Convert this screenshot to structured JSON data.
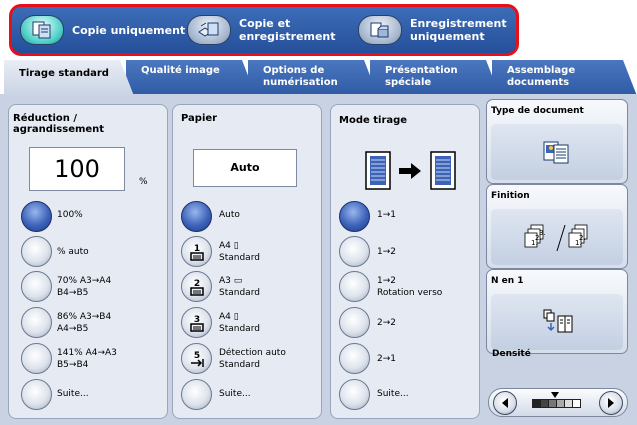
{
  "modes": [
    {
      "label": "Copie uniquement",
      "icon": "copy-icon",
      "active": true
    },
    {
      "label": "Copie et\nenregistrement",
      "icon": "copy-save-icon",
      "active": false
    },
    {
      "label": "Enregistrement\nuniquement",
      "icon": "save-only-icon",
      "active": false
    }
  ],
  "tabs": [
    {
      "label": "Tirage standard",
      "active": true
    },
    {
      "label": "Qualité image",
      "active": false
    },
    {
      "label": "Options de\nnumérisation",
      "active": false
    },
    {
      "label": "Présentation\nspéciale",
      "active": false
    },
    {
      "label": "Assemblage\ndocuments",
      "active": false
    }
  ],
  "reduction": {
    "title": "Réduction / agrandissement",
    "value": "100",
    "unit": "%",
    "options": [
      {
        "label": "100%",
        "selected": true
      },
      {
        "label": "% auto",
        "selected": false
      },
      {
        "label": "70% A3→A4\nB4→B5",
        "selected": false
      },
      {
        "label": "86% A3→B4\nA4→B5",
        "selected": false
      },
      {
        "label": "141% A4→A3\nB5→B4",
        "selected": false
      },
      {
        "label": "Suite...",
        "selected": false
      }
    ]
  },
  "paper": {
    "title": "Papier",
    "value": "Auto",
    "options": [
      {
        "label": "Auto",
        "tray": "",
        "selected": true
      },
      {
        "label": "A4 ▯\nStandard",
        "tray": "1",
        "selected": false
      },
      {
        "label": "A3 ▭\nStandard",
        "tray": "2",
        "selected": false
      },
      {
        "label": "A4 ▯\nStandard",
        "tray": "3",
        "selected": false
      },
      {
        "label": "Détection auto\nStandard",
        "tray": "5",
        "selected": false
      },
      {
        "label": "Suite...",
        "tray": "",
        "selected": false
      }
    ]
  },
  "mode_tirage": {
    "title": "Mode tirage",
    "options": [
      {
        "label": "1→1",
        "selected": true
      },
      {
        "label": "1→2",
        "selected": false
      },
      {
        "label": "1→2\nRotation verso",
        "selected": false
      },
      {
        "label": "2→2",
        "selected": false
      },
      {
        "label": "2→1",
        "selected": false
      },
      {
        "label": "Suite...",
        "selected": false
      }
    ]
  },
  "side": {
    "document_type": "Type de document",
    "finishing": "Finition",
    "n_up": "N en 1",
    "density": "Densité",
    "density_level": 0.5
  },
  "colors": {
    "accent": "#2f5aa5",
    "selected": "#3d63b9",
    "highlight": "#e6101a",
    "active_mode": "#4fd0c8"
  }
}
